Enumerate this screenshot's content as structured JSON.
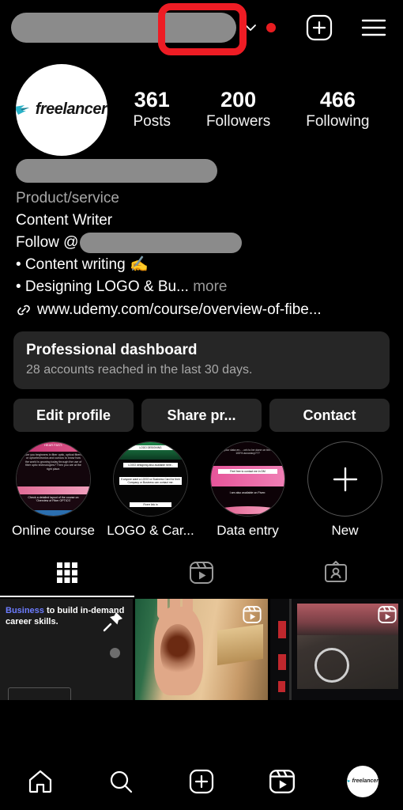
{
  "topbar": {
    "username_redacted": true,
    "chevron_icon": "chevron-down-icon",
    "notification_dot_color": "#e81c20",
    "create_icon": "plus-square-icon",
    "menu_icon": "hamburger-menu-icon"
  },
  "profile": {
    "avatar_logo_text": "freelancer",
    "stats": [
      {
        "num": "361",
        "label": "Posts"
      },
      {
        "num": "200",
        "label": "Followers"
      },
      {
        "num": "466",
        "label": "Following"
      }
    ],
    "name_redacted": true,
    "category": "Product/service",
    "bio_title": "Content Writer",
    "follow_prefix": "Follow @",
    "bio_line_1": "• Content writing ✍️",
    "bio_line_2": "• Designing LOGO & Bu...",
    "more_label": "more",
    "link": "www.udemy.com/course/overview-of-fibe..."
  },
  "dashboard": {
    "title": "Professional dashboard",
    "subtitle": "28 accounts reached in the last 30 days."
  },
  "actions": [
    {
      "label": "Edit profile"
    },
    {
      "label": "Share pr..."
    },
    {
      "label": "Contact"
    }
  ],
  "highlights": [
    {
      "label": "Online course",
      "thumb_lines": [
        "HEAR FAST:",
        "Are you beginners in fiber optic, optical fibers or optoelectronics and curious to know how the world is growing today through the use of fiber optic technologies? Then you are at the right place.",
        "Check a detailed layout of the course on 'Overview of Fiber OPTICS'",
        "udemy.com"
      ]
    },
    {
      "label": "LOGO & Car...",
      "thumb_lines": [
        "LOGO DESIGNING",
        "LOGO designing also available here..",
        "If anyone want a LOGO or Business Card for their Company or Business can contact me.",
        "Fiverr link in"
      ]
    },
    {
      "label": "Data entry",
      "thumb_lines": [
        "..ant your data en.. ..ork to be done on tim.. with 100% accuracy???",
        "Feel free to contact me in DM",
        "I am also available on Fiverr."
      ]
    },
    {
      "label": "New",
      "is_new": true,
      "icon": "plus-icon"
    }
  ],
  "tabs": [
    {
      "name": "grid",
      "icon": "grid-icon",
      "active": true
    },
    {
      "name": "reels",
      "icon": "reels-icon",
      "active": false,
      "highlighted": true
    },
    {
      "name": "tagged",
      "icon": "tagged-person-icon",
      "active": false
    }
  ],
  "highlight_box_color": "#ee1c24",
  "posts": [
    {
      "type": "pinned-text-post",
      "text_part_1": "Business",
      "text_part_2": " to build in-demand career skills.",
      "pin_icon": "pushpin-icon"
    },
    {
      "type": "reel",
      "description": "henna mehndi hand",
      "badge_icon": "reels-icon"
    },
    {
      "type": "reel",
      "description": "street bicycle scene",
      "badge_icon": "reels-icon"
    }
  ],
  "bottomnav": [
    {
      "name": "home",
      "icon": "home-icon"
    },
    {
      "name": "search",
      "icon": "search-icon"
    },
    {
      "name": "create",
      "icon": "plus-square-icon"
    },
    {
      "name": "reels",
      "icon": "reels-icon"
    },
    {
      "name": "profile",
      "icon": "profile-avatar",
      "avatar_text": "freelancer"
    }
  ]
}
